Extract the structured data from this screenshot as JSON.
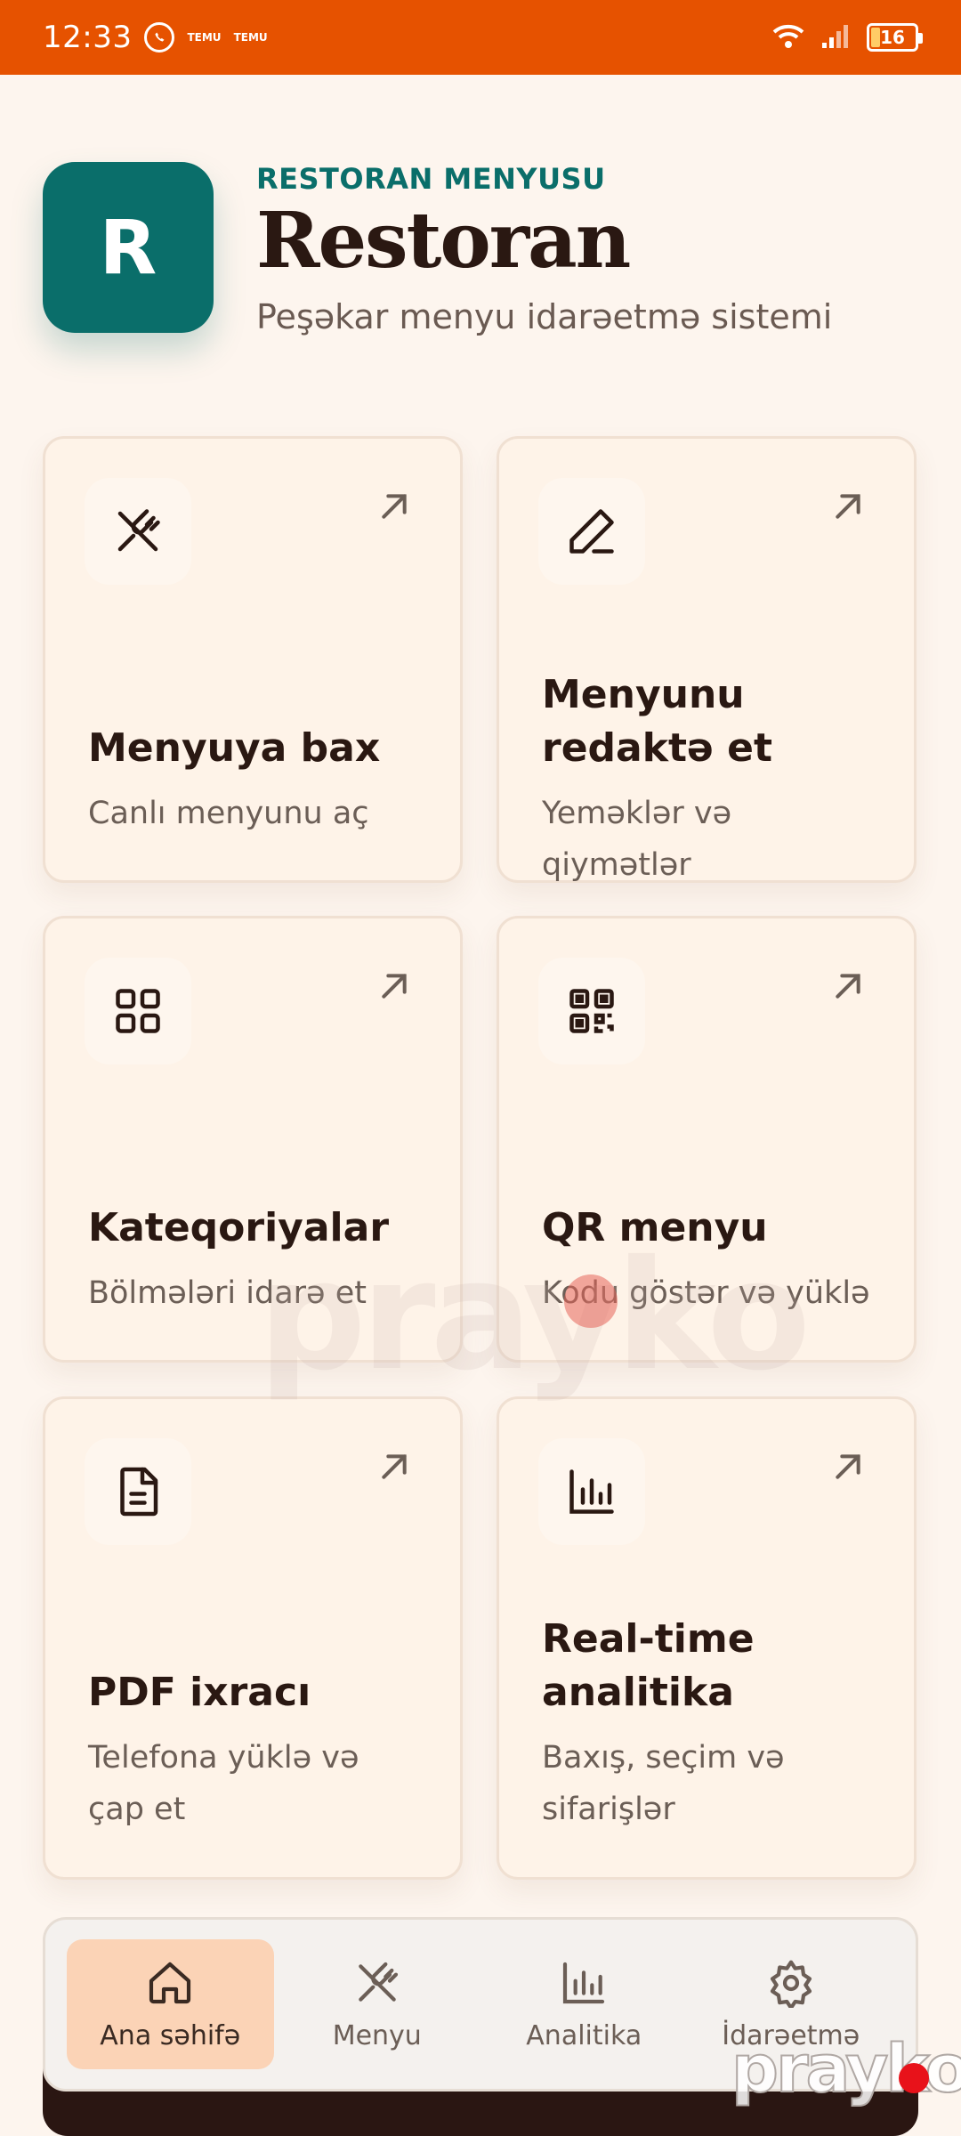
{
  "status_bar": {
    "time": "12:33",
    "temu_label": "TEMU",
    "battery": "16",
    "icons": [
      "whatsapp-icon",
      "temu-icon",
      "wifi-icon",
      "signal-icon",
      "battery-icon"
    ]
  },
  "header": {
    "logo_letter": "R",
    "eyebrow": "RESTORAN MENYUSU",
    "title": "Restoran",
    "subtitle": "Peşəkar menyu idarəetmə sistemi"
  },
  "cards": [
    {
      "title": "Menyuya bax",
      "subtitle": "Canlı menyunu aç",
      "icon": "fork-knife-icon"
    },
    {
      "title": "Menyunu redaktə et",
      "subtitle": "Yeməklər və qiymətlər",
      "icon": "pencil-icon"
    },
    {
      "title": "Kateqoriyalar",
      "subtitle": "Bölmələri idarə et",
      "icon": "grid-icon"
    },
    {
      "title": "QR menyu",
      "subtitle": "Kodu göstər və yüklə",
      "icon": "qr-code-icon"
    },
    {
      "title": "PDF ixracı",
      "subtitle": "Telefona yüklə və çap et",
      "icon": "document-icon"
    },
    {
      "title": "Real-time analitika",
      "subtitle": "Baxış, seçim və sifarişlər",
      "icon": "bar-chart-icon"
    }
  ],
  "nav": {
    "items": [
      {
        "label": "Ana səhifə",
        "icon": "home-icon",
        "active": true
      },
      {
        "label": "Menyu",
        "icon": "fork-knife-icon",
        "active": false
      },
      {
        "label": "Analitika",
        "icon": "bar-chart-icon",
        "active": false
      },
      {
        "label": "İdarəetmə",
        "icon": "gear-icon",
        "active": false
      }
    ]
  },
  "watermark": "prayko",
  "colors": {
    "status_bar": "#e65200",
    "accent": "#0a6e6a",
    "background": "#fdf5ee",
    "nav_active": "#fbd3b6"
  }
}
